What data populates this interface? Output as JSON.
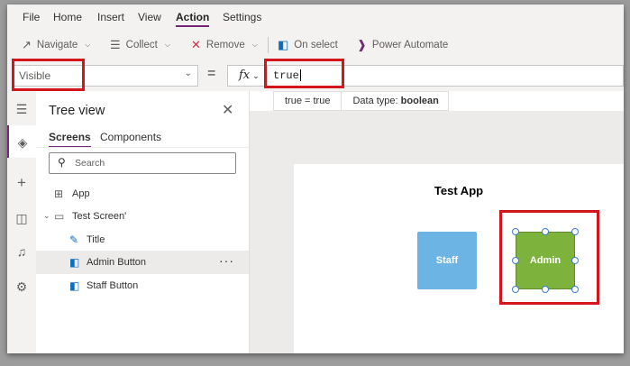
{
  "menubar": {
    "items": [
      "File",
      "Home",
      "Insert",
      "View",
      "Action",
      "Settings"
    ],
    "active": "Action"
  },
  "ribbon": {
    "navigate": {
      "label": "Navigate",
      "icon": "arrow-icon"
    },
    "collect": {
      "label": "Collect",
      "icon": "list-icon"
    },
    "remove": {
      "label": "Remove",
      "icon": "x-icon"
    },
    "on_select": {
      "label": "On select",
      "icon": "cursor-box-icon"
    },
    "power_automate": {
      "label": "Power Automate",
      "icon": "power-automate-icon"
    }
  },
  "formula_bar": {
    "property": "Visible",
    "equals": "=",
    "fx": "fx",
    "value": "true",
    "hint_expression": "true  =  true",
    "hint_type_label": "Data type:",
    "hint_type_value": "boolean"
  },
  "tree_view": {
    "title": "Tree view",
    "tabs": [
      "Screens",
      "Components"
    ],
    "active_tab": "Screens",
    "search_placeholder": "Search",
    "nodes": {
      "app": "App",
      "screen": "Test Screen'",
      "title": "Title",
      "admin_button": "Admin Button",
      "staff_button": "Staff Button"
    },
    "selected": "Admin Button",
    "more": "···"
  },
  "canvas": {
    "app_title": "Test App",
    "staff_button": "Staff",
    "admin_button": "Admin"
  },
  "colors": {
    "accent": "#742774",
    "highlight": "#d4161c",
    "staff_button": "#6cb4e3",
    "admin_button": "#7db33c"
  }
}
